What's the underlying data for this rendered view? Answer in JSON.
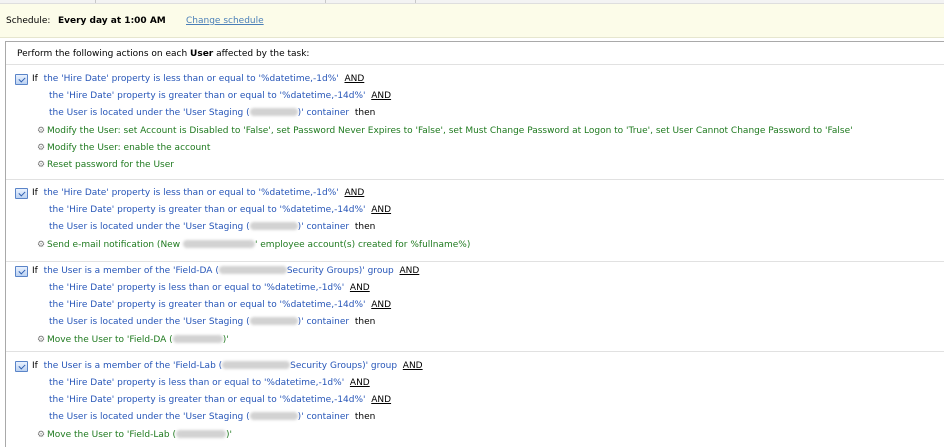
{
  "schedule": {
    "label": "Schedule:",
    "value": "Every day at 1:00 AM",
    "change_link": "Change schedule"
  },
  "panel": {
    "header_prefix": "Perform the following actions on each ",
    "header_object": "User",
    "header_suffix": " affected by the task:"
  },
  "common": {
    "if": "If",
    "and": "AND",
    "then": "then"
  },
  "rules": [
    {
      "conditions": [
        "the 'Hire Date' property is less than or equal to '%datetime,-1d%'",
        "the 'Hire Date' property is greater than or equal to '%datetime,-14d%'",
        {
          "pre": "the User is located under the 'User Staging (",
          "post": ")' container"
        }
      ],
      "actions": [
        "Modify the User: set Account is Disabled to 'False', set Password Never Expires to 'False', set Must Change Password at Logon to 'True', set User Cannot Change Password to 'False'",
        "Modify the User: enable the account",
        "Reset password for the User"
      ]
    },
    {
      "conditions": [
        "the 'Hire Date' property is less than or equal to '%datetime,-1d%'",
        "the 'Hire Date' property is greater than or equal to '%datetime,-14d%'",
        {
          "pre": "the User is located under the 'User Staging (",
          "post": ")' container"
        }
      ],
      "actions": [
        {
          "pre": "Send e-mail notification (New ",
          "post": "' employee account(s) created for %fullname%)"
        }
      ]
    },
    {
      "conditions": [
        {
          "pre": "the User is a member of the 'Field-DA (",
          "post": "Security Groups)' group"
        },
        "the 'Hire Date' property is less than or equal to '%datetime,-1d%'",
        "the 'Hire Date' property is greater than or equal to '%datetime,-14d%'",
        {
          "pre": "the User is located under the 'User Staging (",
          "post": ")' container"
        }
      ],
      "actions": [
        {
          "pre": "Move the User to 'Field-DA (",
          "post": ")'"
        }
      ]
    },
    {
      "conditions": [
        {
          "pre": "the User is a member of the 'Field-Lab (",
          "post": "Security Groups)' group"
        },
        "the 'Hire Date' property is less than or equal to '%datetime,-1d%'",
        "the 'Hire Date' property is greater than or equal to '%datetime,-14d%'",
        {
          "pre": "the User is located under the 'User Staging (",
          "post": ")' container"
        }
      ],
      "actions": [
        {
          "pre": "Move the User to 'Field-Lab (",
          "post": ")'"
        }
      ]
    }
  ]
}
